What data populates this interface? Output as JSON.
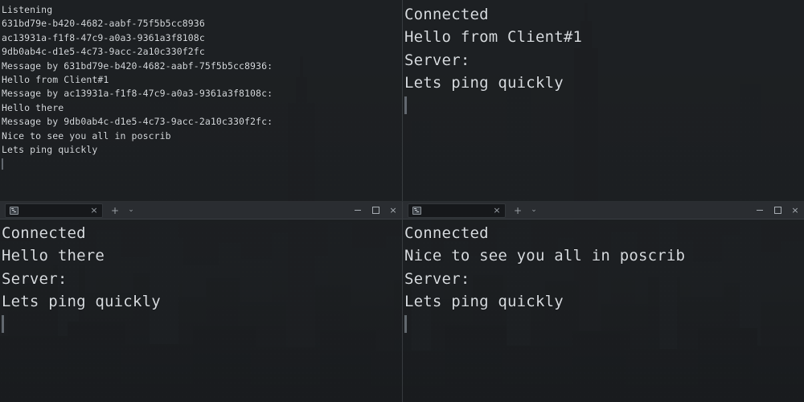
{
  "window": {
    "titlebar": {
      "tab_title": "",
      "tab_icon": "terminal-icon",
      "close_label": "×",
      "new_tab_label": "+",
      "tab_menu_label": "⌄",
      "minimize_label": "",
      "maximize_label": "",
      "window_close_label": "×"
    }
  },
  "terminals": [
    {
      "id": "server",
      "position": "top-left",
      "font_size": "small",
      "has_titlebar": false,
      "lines": [
        "Listening",
        "631bd79e-b420-4682-aabf-75f5b5cc8936",
        "ac13931a-f1f8-47c9-a0a3-9361a3f8108c",
        "9db0ab4c-d1e5-4c73-9acc-2a10c330f2fc",
        "Message by 631bd79e-b420-4682-aabf-75f5b5cc8936:",
        "Hello from Client#1",
        "Message by ac13931a-f1f8-47c9-a0a3-9361a3f8108c:",
        "Hello there",
        "Message by 9db0ab4c-d1e5-4c73-9acc-2a10c330f2fc:",
        "Nice to see you all in poscrib",
        "Lets ping quickly"
      ]
    },
    {
      "id": "client-1",
      "position": "top-right",
      "font_size": "big",
      "has_titlebar": false,
      "lines": [
        "Connected",
        "Hello from Client#1",
        "Server:",
        "Lets ping quickly"
      ]
    },
    {
      "id": "client-2",
      "position": "bottom-left",
      "font_size": "big",
      "has_titlebar": true,
      "lines": [
        "Connected",
        "Hello there",
        "Server:",
        "Lets ping quickly"
      ]
    },
    {
      "id": "client-3",
      "position": "bottom-right",
      "font_size": "big",
      "has_titlebar": true,
      "lines": [
        "Connected",
        "Nice to see you all in poscrib",
        "Server:",
        "Lets ping quickly"
      ]
    }
  ],
  "colors": {
    "terminal_text": "#d7dbdf",
    "terminal_bg": "#181a1d",
    "titlebar_bg": "#2c2f33",
    "tab_bg": "#16181b",
    "control_icon": "#a7adb3"
  },
  "wallpaper": {
    "name": "city-skyline-wallpaper",
    "description": "dark monochrome New York City skyline"
  }
}
